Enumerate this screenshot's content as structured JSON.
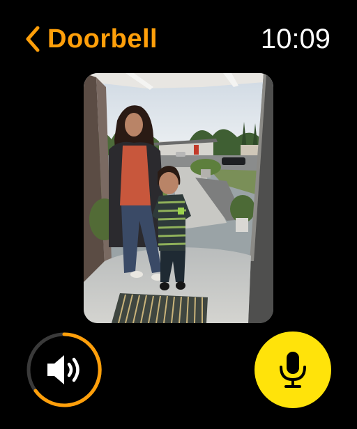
{
  "header": {
    "back_label": "Doorbell",
    "time": "10:09"
  },
  "camera_feed": {
    "description_icon": "doorbell-camera-feed"
  },
  "controls": {
    "speaker": {
      "icon": "speaker-volume-icon",
      "ring_color": "#FF9F0A"
    },
    "microphone": {
      "icon": "microphone-icon",
      "background": "#FFE30A"
    }
  },
  "colors": {
    "accent": "#FF9F0A",
    "mic_yellow": "#FFE30A",
    "background": "#000000"
  }
}
